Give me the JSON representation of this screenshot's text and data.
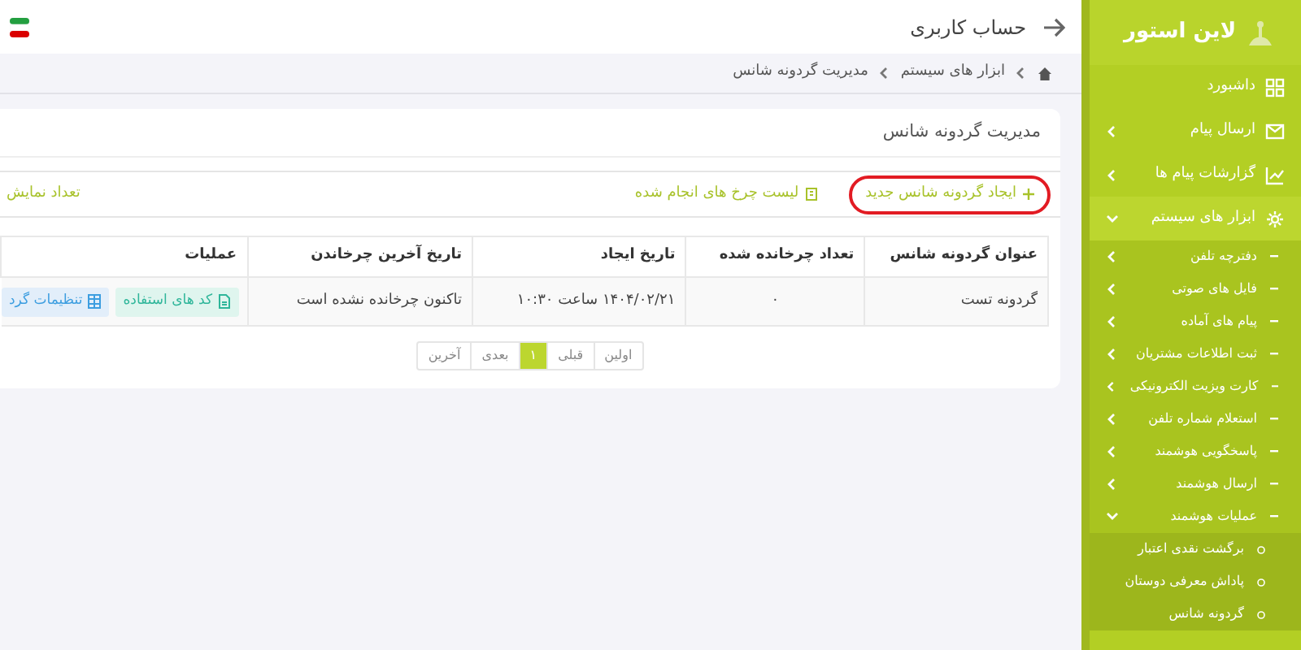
{
  "sidebar": {
    "brand": "لاین استور",
    "items": [
      {
        "label": "داشبورد"
      },
      {
        "label": "ارسال پیام",
        "expanded": false
      },
      {
        "label": "گزارشات پیام ها",
        "expanded": false
      },
      {
        "label": "ابزار های سیستم",
        "expanded": true,
        "children": [
          {
            "label": "دفترچه تلفن",
            "expanded": false
          },
          {
            "label": "فایل های صوتی",
            "expanded": false
          },
          {
            "label": "پیام های آماده",
            "expanded": false
          },
          {
            "label": "ثبت اطلاعات مشتریان",
            "expanded": false
          },
          {
            "label": "کارت ویزیت الکترونیکی",
            "expanded": false
          },
          {
            "label": "استعلام شماره تلفن",
            "expanded": false
          },
          {
            "label": "پاسخگویی هوشمند",
            "expanded": false
          },
          {
            "label": "ارسال هوشمند",
            "expanded": false
          },
          {
            "label": "عملیات هوشمند",
            "expanded": true,
            "children": [
              {
                "label": "برگشت نقدی اعتبار"
              },
              {
                "label": "پاداش معرفی دوستان"
              },
              {
                "label": "گردونه شانس"
              }
            ]
          }
        ]
      }
    ]
  },
  "header": {
    "title": "حساب کاربری"
  },
  "breadcrumb": [
    "ابزار های سیستم",
    "مدیریت گردونه شانس"
  ],
  "card": {
    "title": "مدیریت گردونه شانس",
    "toolbar": {
      "actions": [
        {
          "label": "ایجاد گردونه شانس جدید",
          "kind": "add",
          "highlighted": true
        },
        {
          "label": "لیست چرخ های انجام شده",
          "kind": "list",
          "highlighted": false
        }
      ],
      "display_count_label": "تعداد نمایش"
    },
    "table": {
      "columns": [
        "عنوان گردونه شانس",
        "تعداد چرخانده شده",
        "تاریخ ایجاد",
        "تاریخ آخرین چرخاندن",
        "عملیات"
      ],
      "rows": [
        {
          "cells": [
            "گردونه تست",
            "۰",
            "۱۴۰۴/۰۲/۲۱ ساعت ۱۰:۳۰",
            "تاکنون چرخانده نشده است"
          ],
          "actions": [
            {
              "label": "کد های استفاده",
              "kind": "codes"
            },
            {
              "label": "تنظیمات گرد",
              "kind": "settings"
            }
          ]
        }
      ]
    },
    "pagination": [
      {
        "label": "اولین",
        "selected": false
      },
      {
        "label": "قبلی",
        "selected": false
      },
      {
        "label": "۱",
        "selected": true
      },
      {
        "label": "بعدی",
        "selected": false
      },
      {
        "label": "آخرین",
        "selected": false
      }
    ]
  }
}
